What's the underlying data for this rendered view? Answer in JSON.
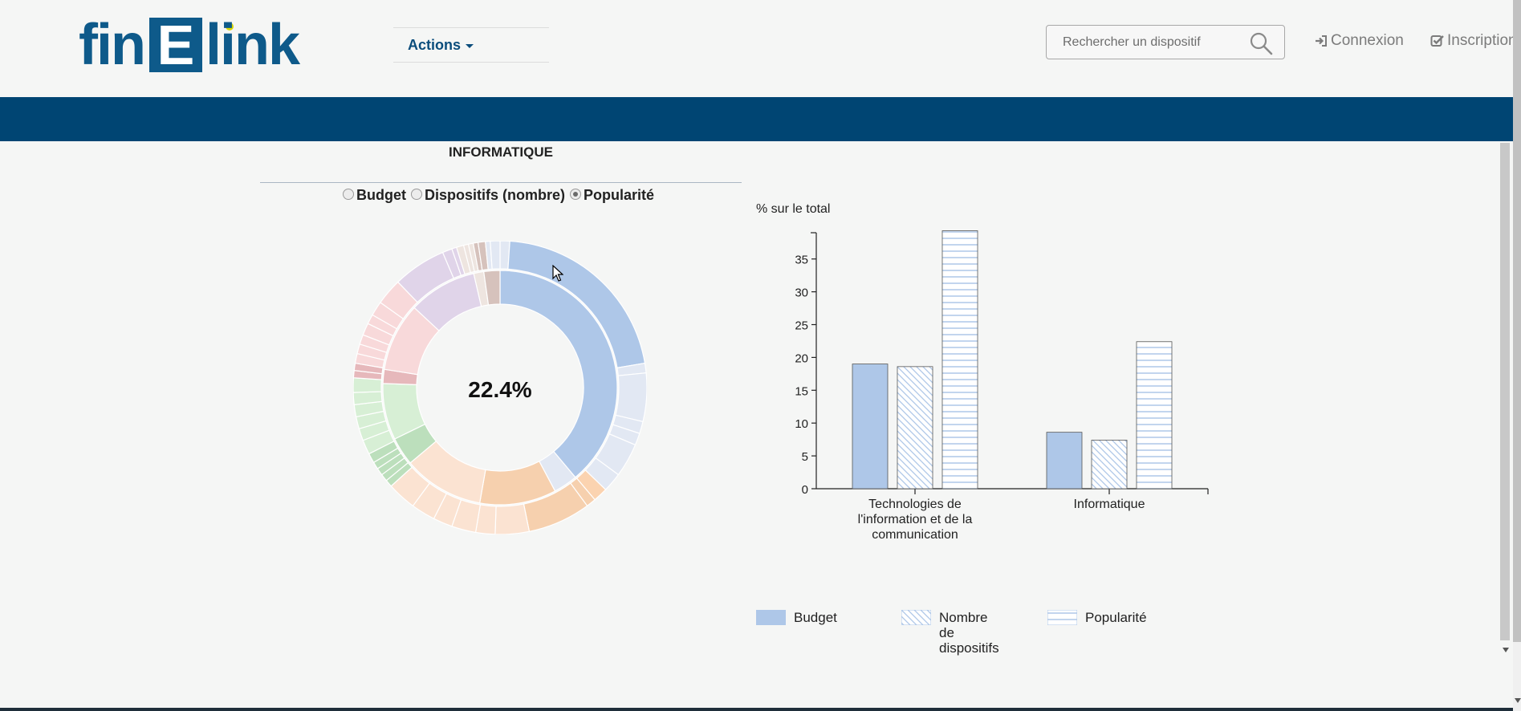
{
  "header": {
    "logo": {
      "part1": "fin",
      "letter": "E",
      "part2": "link"
    },
    "actions_label": "Actions",
    "search_placeholder": "Rechercher un dispositif",
    "login_label": "Connexion",
    "signup_label": "Inscription"
  },
  "section": {
    "title": "INFORMATIQUE",
    "radio_options": [
      {
        "label": "Budget",
        "checked": false
      },
      {
        "label": "Dispositifs (nombre)",
        "checked": false
      },
      {
        "label": "Popularité",
        "checked": true
      }
    ],
    "donut_center_value": "22.4%"
  },
  "colors": {
    "brand_blue": "#004573",
    "logo_blue": "#0e5a8a",
    "logo_dot": "#d8d600",
    "bar_fill": "#aec7e8",
    "bar_stroke": "#4a4a4a"
  },
  "chart_data": {
    "type": "bar",
    "ylabel": "% sur le total",
    "ylim": [
      0,
      39
    ],
    "yticks": [
      "0",
      "5",
      "10",
      "15",
      "20",
      "25",
      "30",
      "35"
    ],
    "categories": [
      "Technologies de l'information et de la communication",
      "Informatique"
    ],
    "category_lines": [
      [
        "Technologies de",
        "l'information et de la",
        "communication"
      ],
      [
        "Informatique"
      ]
    ],
    "series": [
      {
        "name": "Budget",
        "pattern": "solid",
        "values": [
          19,
          8.6
        ]
      },
      {
        "name": "Nombre de dispositifs",
        "pattern": "diagonal",
        "values": [
          18.6,
          7.4
        ]
      },
      {
        "name": "Popularité",
        "pattern": "horizontal",
        "values": [
          39.3,
          22.4
        ]
      }
    ],
    "legend": [
      {
        "label_lines": [
          "Budget"
        ]
      },
      {
        "label_lines": [
          "Nombre",
          "de",
          "dispositifs"
        ]
      },
      {
        "label_lines": [
          "Popularité"
        ]
      }
    ]
  }
}
